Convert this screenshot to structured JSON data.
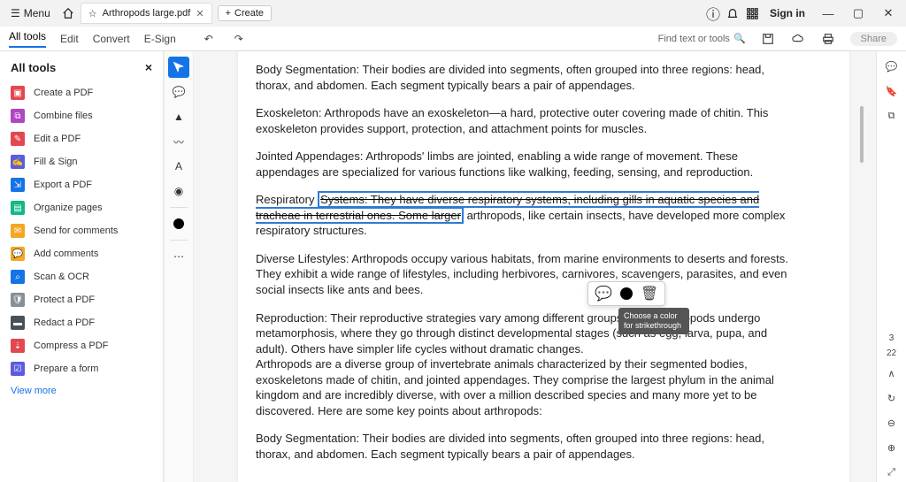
{
  "titlebar": {
    "menu": "Menu",
    "filename": "Arthropods large.pdf",
    "create": "Create",
    "signin": "Sign in"
  },
  "ribbon": {
    "all_tools": "All tools",
    "edit": "Edit",
    "convert": "Convert",
    "esign": "E-Sign",
    "find": "Find text or tools",
    "share": "Share"
  },
  "sidebar": {
    "title": "All tools",
    "items": [
      {
        "label": "Create a PDF",
        "color": "#e34850"
      },
      {
        "label": "Combine files",
        "color": "#b146c2"
      },
      {
        "label": "Edit a PDF",
        "color": "#e34850"
      },
      {
        "label": "Fill & Sign",
        "color": "#5c5ce0"
      },
      {
        "label": "Export a PDF",
        "color": "#1473e6"
      },
      {
        "label": "Organize pages",
        "color": "#12b886"
      },
      {
        "label": "Send for comments",
        "color": "#f5a623"
      },
      {
        "label": "Add comments",
        "color": "#f5a623"
      },
      {
        "label": "Scan & OCR",
        "color": "#1473e6"
      },
      {
        "label": "Protect a PDF",
        "color": "#868e96"
      },
      {
        "label": "Redact a PDF",
        "color": "#495057"
      },
      {
        "label": "Compress a PDF",
        "color": "#e34850"
      },
      {
        "label": "Prepare a form",
        "color": "#5c5ce0"
      }
    ],
    "view_more": "View more"
  },
  "doc": {
    "p1": "Body Segmentation: Their bodies are divided into segments, often grouped into three regions: head, thorax, and abdomen. Each segment typically bears a pair of appendages.",
    "p2": "Exoskeleton: Arthropods have an exoskeleton—a hard, protective outer covering made of chitin. This exoskeleton provides support, protection, and attachment points for muscles.",
    "p3": "Jointed Appendages: Arthropods' limbs are jointed, enabling a wide range of movement. These appendages are specialized for various functions like walking, feeding, sensing, and reproduction.",
    "p4_pre": "Respiratory ",
    "p4_strike": "Systems: They have diverse respiratory systems, including gills in aquatic species and tracheae in terrestrial ones. Some larger",
    "p4_post": " arthropods, like certain insects, have developed more complex respiratory structures.",
    "p5": "Diverse Lifestyles: Arthropods occupy various habitats, from marine environments to deserts and forests. They exhibit a wide range of lifestyles, including herbivores, carnivores, scavengers, parasites, and even social insects like ants and bees.",
    "p6": "Reproduction: Their reproductive strategies vary among different groups. Many arthropods undergo metamorphosis, where they go through distinct developmental stages (such as egg, larva, pupa, and adult). Others have simpler life cycles without dramatic changes.",
    "p7": "Arthropods are a diverse group of invertebrate animals characterized by their segmented bodies, exoskeletons made of chitin, and jointed appendages. They comprise the largest phylum in the animal kingdom and are incredibly diverse, with over a million described species and many more yet to be discovered. Here are some key points about arthropods:",
    "p8": "Body Segmentation: Their bodies are divided into segments, often grouped into three regions: head, thorax, and abdomen. Each segment typically bears a pair of appendages."
  },
  "tooltip": "Choose a color for strikethrough",
  "rightpanel": {
    "page": "3",
    "total": "22"
  }
}
